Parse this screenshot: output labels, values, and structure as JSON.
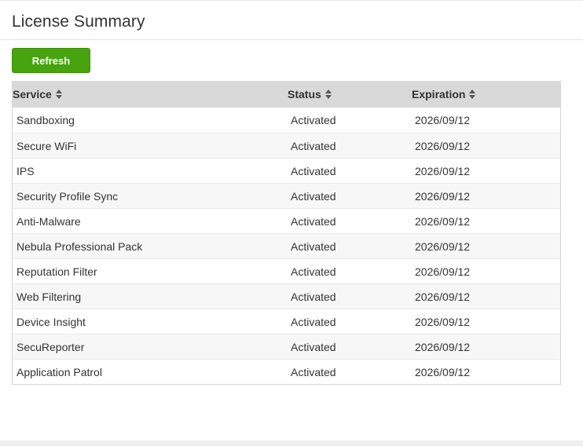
{
  "header": {
    "title": "License Summary"
  },
  "toolbar": {
    "refresh_label": "Refresh"
  },
  "table": {
    "columns": [
      "Service",
      "Status",
      "Expiration"
    ],
    "sort_icon": "sort-updown-icon",
    "rows": [
      [
        "Sandboxing",
        "Activated",
        "2026/09/12"
      ],
      [
        "Secure WiFi",
        "Activated",
        "2026/09/12"
      ],
      [
        "IPS",
        "Activated",
        "2026/09/12"
      ],
      [
        "Security Profile Sync",
        "Activated",
        "2026/09/12"
      ],
      [
        "Anti-Malware",
        "Activated",
        "2026/09/12"
      ],
      [
        "Nebula Professional Pack",
        "Activated",
        "2026/09/12"
      ],
      [
        "Reputation Filter",
        "Activated",
        "2026/09/12"
      ],
      [
        "Web Filtering",
        "Activated",
        "2026/09/12"
      ],
      [
        "Device Insight",
        "Activated",
        "2026/09/12"
      ],
      [
        "SecuReporter",
        "Activated",
        "2026/09/12"
      ],
      [
        "Application Patrol",
        "Activated",
        "2026/09/12"
      ]
    ]
  },
  "colors": {
    "accent": "#47a40f",
    "header_bg": "#d9d9d9",
    "row_alt_bg": "#f7f7f7",
    "text": "#333333"
  }
}
